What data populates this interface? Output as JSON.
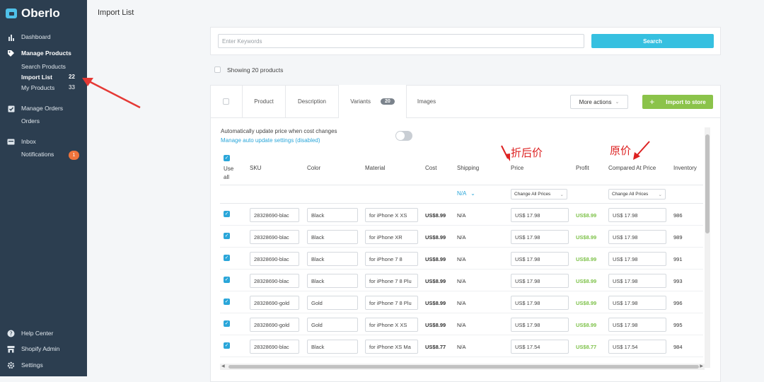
{
  "brand": {
    "name": "Oberlo"
  },
  "sidebar": {
    "items": [
      {
        "label": "Dashboard"
      },
      {
        "label": "Manage Products"
      },
      {
        "label": "Search Products"
      },
      {
        "label": "Import List",
        "count": "22"
      },
      {
        "label": "My Products",
        "count": "33"
      },
      {
        "label": "Manage Orders"
      },
      {
        "label": "Orders"
      },
      {
        "label": "Inbox"
      },
      {
        "label": "Notifications",
        "count": "1"
      },
      {
        "label": "Help Center"
      },
      {
        "label": "Shopify Admin"
      },
      {
        "label": "Settings"
      }
    ]
  },
  "page": {
    "title": "Import List"
  },
  "search": {
    "placeholder": "Enter Keywords",
    "button": "Search"
  },
  "showing": "Showing 20 products",
  "tabs": [
    {
      "label": "Product"
    },
    {
      "label": "Description"
    },
    {
      "label": "Variants",
      "badge": "20"
    },
    {
      "label": "Images"
    }
  ],
  "actions": {
    "more": "More actions",
    "import": "Import to store"
  },
  "auto_update": {
    "text": "Automatically update price when cost changes",
    "link": "Manage auto update settings (disabled)"
  },
  "annotations": {
    "price_cn": "折后价",
    "compare_cn": "原价"
  },
  "columns": {
    "use_all": "Use all",
    "sku": "SKU",
    "color": "Color",
    "material": "Material",
    "cost": "Cost",
    "shipping": "Shipping",
    "price": "Price",
    "profit": "Profit",
    "compared": "Compared At Price",
    "inventory": "Inventory"
  },
  "filters": {
    "shipping": "N/A",
    "price": "Change All Prices",
    "compared": "Change All Prices"
  },
  "rows": [
    {
      "sku": "28328690-blac",
      "color": "Black",
      "material": "for iPhone X XS",
      "cost": "US$8.99",
      "shipping": "N/A",
      "price": "US$  17.98",
      "profit": "US$8.99",
      "compared": "US$  17.98",
      "inventory": "986"
    },
    {
      "sku": "28328690-blac",
      "color": "Black",
      "material": "for iPhone XR",
      "cost": "US$8.99",
      "shipping": "N/A",
      "price": "US$  17.98",
      "profit": "US$8.99",
      "compared": "US$  17.98",
      "inventory": "989"
    },
    {
      "sku": "28328690-blac",
      "color": "Black",
      "material": "for iPhone 7 8",
      "cost": "US$8.99",
      "shipping": "N/A",
      "price": "US$  17.98",
      "profit": "US$8.99",
      "compared": "US$  17.98",
      "inventory": "991"
    },
    {
      "sku": "28328690-blac",
      "color": "Black",
      "material": "for iPhone 7 8 Plu",
      "cost": "US$8.99",
      "shipping": "N/A",
      "price": "US$  17.98",
      "profit": "US$8.99",
      "compared": "US$  17.98",
      "inventory": "993"
    },
    {
      "sku": "28328690-gold",
      "color": "Gold",
      "material": "for iPhone 7 8 Plu",
      "cost": "US$8.99",
      "shipping": "N/A",
      "price": "US$  17.98",
      "profit": "US$8.99",
      "compared": "US$  17.98",
      "inventory": "996"
    },
    {
      "sku": "28328690-gold",
      "color": "Gold",
      "material": "for iPhone X XS",
      "cost": "US$8.99",
      "shipping": "N/A",
      "price": "US$  17.98",
      "profit": "US$8.99",
      "compared": "US$  17.98",
      "inventory": "995"
    },
    {
      "sku": "28328690-blac",
      "color": "Black",
      "material": "for iPhone XS Ma",
      "cost": "US$8.77",
      "shipping": "N/A",
      "price": "US$  17.54",
      "profit": "US$8.77",
      "compared": "US$  17.54",
      "inventory": "984"
    }
  ]
}
